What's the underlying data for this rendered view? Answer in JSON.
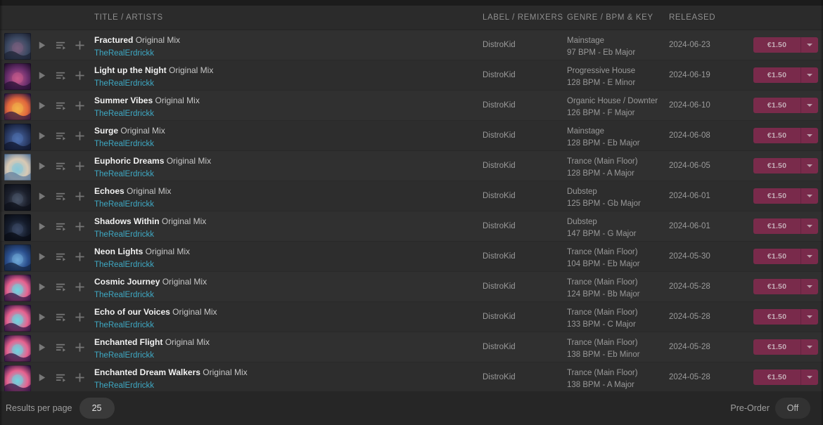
{
  "columns": {
    "title": "TITLE / ARTISTS",
    "label": "LABEL / REMIXERS",
    "genre": "GENRE / BPM & KEY",
    "released": "RELEASED"
  },
  "icons": {
    "play": "play-icon",
    "queue": "add-to-queue-icon",
    "add": "add-to-playlist-icon",
    "caret": "chevron-down-icon"
  },
  "footer": {
    "results_per_page_label": "Results per page",
    "results_per_page_value": "25",
    "preorder_label": "Pre-Order",
    "preorder_value": "Off"
  },
  "colors": {
    "buy_button": "#8a2a52",
    "artist_link": "#3ea9c4",
    "row_bg": "#303030",
    "header_bg": "#2b2b2b"
  },
  "tracks": [
    {
      "title": "Fractured",
      "mix": "Original Mix",
      "artist": "TheRealErdrickk",
      "label": "DistroKid",
      "genre": "Mainstage",
      "bpm_key": "97 BPM - Eb Major",
      "released": "2024-06-23",
      "price": "€1.50",
      "art": [
        "#3d4a63",
        "#7a5f7e",
        "#1d2233"
      ]
    },
    {
      "title": "Light up the Night",
      "mix": "Original Mix",
      "artist": "TheRealErdrickk",
      "label": "DistroKid",
      "genre": "Progressive House",
      "bpm_key": "128 BPM - E Minor",
      "released": "2024-06-19",
      "price": "€1.50",
      "art": [
        "#6a2f6d",
        "#c85a8c",
        "#241030"
      ]
    },
    {
      "title": "Summer Vibes",
      "mix": "Original Mix",
      "artist": "TheRealErdrickk",
      "label": "DistroKid",
      "genre": "Organic House / Downter",
      "bpm_key": "126 BPM - F Major",
      "released": "2024-06-10",
      "price": "€1.50",
      "art": [
        "#e0663c",
        "#f2b24a",
        "#2a1740"
      ]
    },
    {
      "title": "Surge",
      "mix": "Original Mix",
      "artist": "TheRealErdrickk",
      "label": "DistroKid",
      "genre": "Mainstage",
      "bpm_key": "128 BPM - Eb Major",
      "released": "2024-06-08",
      "price": "€1.50",
      "art": [
        "#2b3c66",
        "#4e6fae",
        "#10162b"
      ]
    },
    {
      "title": "Euphoric Dreams",
      "mix": "Original Mix",
      "artist": "TheRealErdrickk",
      "label": "DistroKid",
      "genre": "Trance (Main Floor)",
      "bpm_key": "128 BPM - A Major",
      "released": "2024-06-05",
      "price": "€1.50",
      "art": [
        "#d9c9b4",
        "#88c6d8",
        "#5d7a9c"
      ]
    },
    {
      "title": "Echoes",
      "mix": "Original Mix",
      "artist": "TheRealErdrickk",
      "label": "DistroKid",
      "genre": "Dubstep",
      "bpm_key": "125 BPM - Gb Major",
      "released": "2024-06-01",
      "price": "€1.50",
      "art": [
        "#1b1f2b",
        "#4a5568",
        "#0d1018"
      ]
    },
    {
      "title": "Shadows Within",
      "mix": "Original Mix",
      "artist": "TheRealErdrickk",
      "label": "DistroKid",
      "genre": "Dubstep",
      "bpm_key": "147 BPM - G Major",
      "released": "2024-06-01",
      "price": "€1.50",
      "art": [
        "#141b2a",
        "#3b4a66",
        "#090c14"
      ]
    },
    {
      "title": "Neon Lights",
      "mix": "Original Mix",
      "artist": "TheRealErdrickk",
      "label": "DistroKid",
      "genre": "Trance (Main Floor)",
      "bpm_key": "104 BPM - Eb Major",
      "released": "2024-05-30",
      "price": "€1.50",
      "art": [
        "#2a4e8c",
        "#6fa8d8",
        "#16243f"
      ]
    },
    {
      "title": "Cosmic Journey",
      "mix": "Original Mix",
      "artist": "TheRealErdrickk",
      "label": "DistroKid",
      "genre": "Trance (Main Floor)",
      "bpm_key": "124 BPM - Bb Major",
      "released": "2024-05-28",
      "price": "€1.50",
      "art": [
        "#e8628f",
        "#6fd4e0",
        "#2a1240"
      ]
    },
    {
      "title": "Echo of our Voices",
      "mix": "Original Mix",
      "artist": "TheRealErdrickk",
      "label": "DistroKid",
      "genre": "Trance (Main Floor)",
      "bpm_key": "133 BPM - C Major",
      "released": "2024-05-28",
      "price": "€1.50",
      "art": [
        "#e8628f",
        "#6fd4e0",
        "#2a1240"
      ]
    },
    {
      "title": "Enchanted Flight",
      "mix": "Original Mix",
      "artist": "TheRealErdrickk",
      "label": "DistroKid",
      "genre": "Trance (Main Floor)",
      "bpm_key": "138 BPM - Eb Minor",
      "released": "2024-05-28",
      "price": "€1.50",
      "art": [
        "#e8628f",
        "#6fd4e0",
        "#2a1240"
      ]
    },
    {
      "title": "Enchanted Dream Walkers",
      "mix": "Original Mix",
      "artist": "TheRealErdrickk",
      "label": "DistroKid",
      "genre": "Trance (Main Floor)",
      "bpm_key": "138 BPM - A Major",
      "released": "2024-05-28",
      "price": "€1.50",
      "art": [
        "#e8628f",
        "#6fd4e0",
        "#2a1240"
      ]
    }
  ]
}
